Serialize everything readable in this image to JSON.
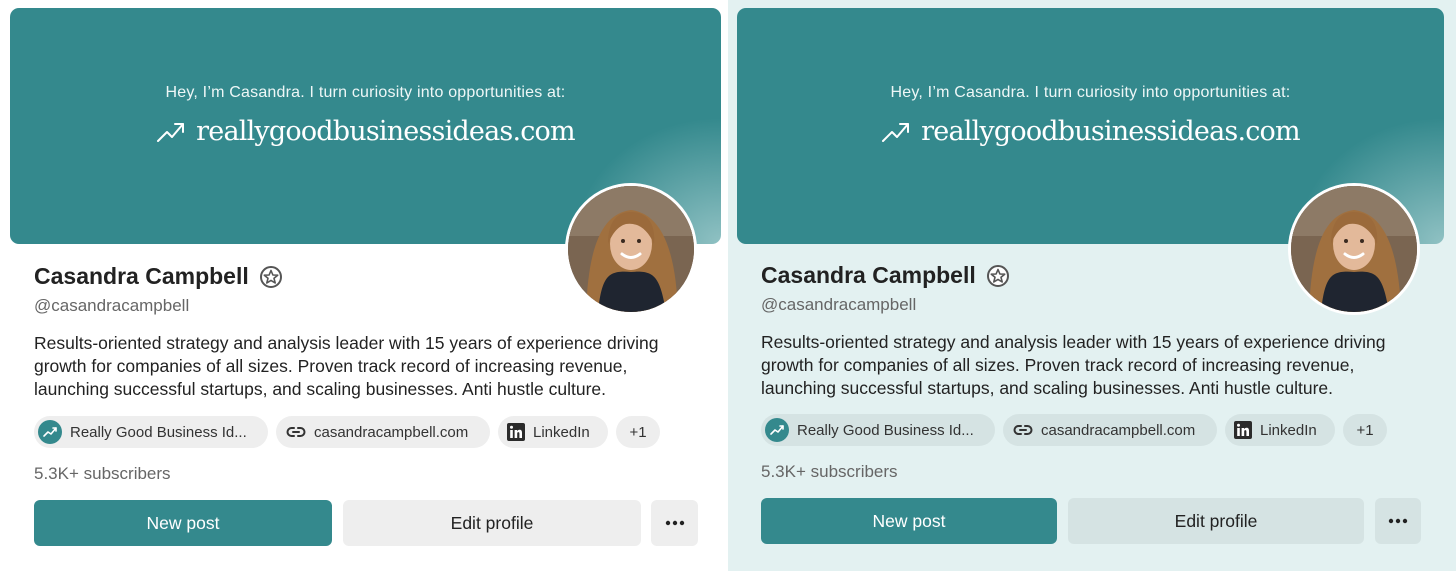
{
  "panels": [
    {
      "variant": "light",
      "background": "#ffffff",
      "banner": {
        "color": "#34898d",
        "tagline": "Hey, I’m Casandra. I turn curiosity into opportunities at:",
        "site": "reallygoodbusinessideas.com",
        "icon": "trending-up-icon"
      },
      "profile": {
        "name": "Casandra Campbell",
        "handle": "@casandracampbell",
        "bio": [
          "Results-oriented strategy and analysis leader with 15 years of experience driving",
          "growth for companies of all sizes. Proven track record of increasing revenue,",
          "launching successful startups, and scaling businesses. Anti hustle culture."
        ],
        "links": {
          "publication": "Really Good Business Id...",
          "website": "casandracampbell.com",
          "linkedin": "LinkedIn",
          "more": "+1"
        },
        "subscribers": "5.3K+ subscribers"
      },
      "actions": {
        "new_post": "New post",
        "edit_profile": "Edit profile",
        "more_icon": "ellipsis-icon"
      }
    },
    {
      "variant": "tinted",
      "background": "#e3f1f1",
      "banner": {
        "color": "#34898d",
        "tagline": "Hey, I’m Casandra. I turn curiosity into opportunities at:",
        "site": "reallygoodbusinessideas.com",
        "icon": "trending-up-icon"
      },
      "profile": {
        "name": "Casandra Campbell",
        "handle": "@casandracampbell",
        "bio": [
          "Results-oriented strategy and analysis leader with 15 years of experience driving",
          "growth for companies of all sizes. Proven track record of increasing revenue,",
          "launching successful startups, and scaling businesses. Anti hustle culture."
        ],
        "links": {
          "publication": "Really Good Business Id...",
          "website": "casandracampbell.com",
          "linkedin": "LinkedIn",
          "more": "+1"
        },
        "subscribers": "5.3K+ subscribers"
      },
      "actions": {
        "new_post": "New post",
        "edit_profile": "Edit profile",
        "more_icon": "ellipsis-icon"
      }
    }
  ]
}
